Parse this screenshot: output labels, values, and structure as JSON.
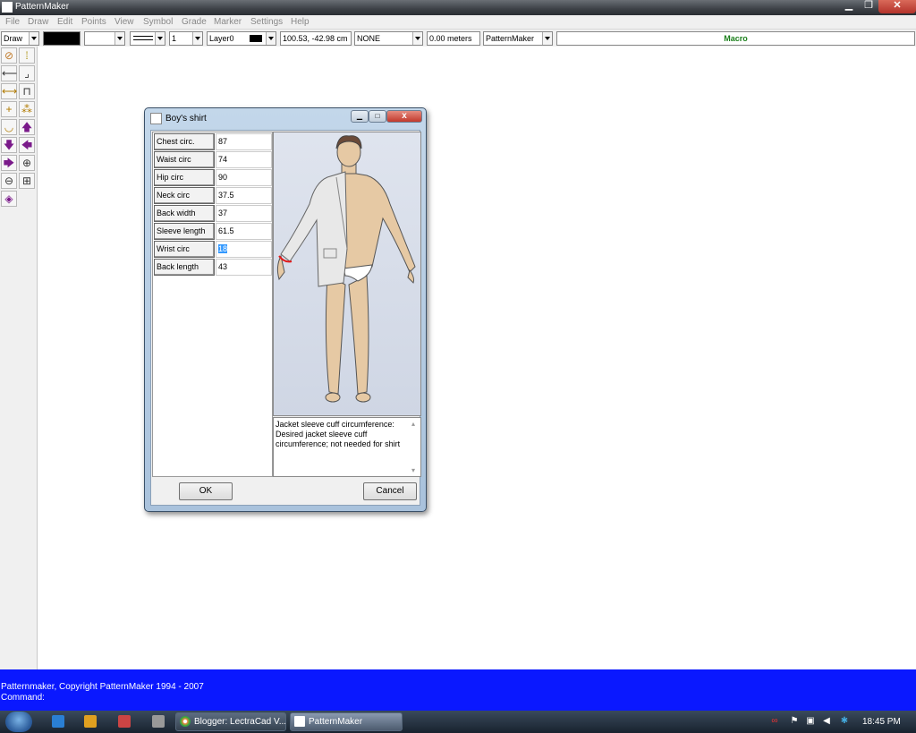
{
  "window": {
    "title": "PatternMaker",
    "min_glyph": "▁",
    "max_glyph": "❐",
    "close_glyph": "✕"
  },
  "menu": [
    "File",
    "Draw",
    "Edit",
    "Points",
    "View",
    "Symbol",
    "Grade",
    "Marker",
    "Settings",
    "Help"
  ],
  "toolbar": {
    "mode": "Draw",
    "line_width": "1",
    "layer": "Layer0",
    "coordinates": "100.53, -42.98 cm",
    "snap": "NONE",
    "distance": "0.00 meters",
    "app": "PatternMaker",
    "macro": "Macro"
  },
  "dialog": {
    "title": "Boy's shirt",
    "min_glyph": "▁",
    "max_glyph": "□",
    "close_glyph": "x",
    "measurements": [
      {
        "label": "Chest circ.",
        "value": "87"
      },
      {
        "label": "Waist circ",
        "value": "74"
      },
      {
        "label": "Hip circ",
        "value": "90"
      },
      {
        "label": "Neck circ",
        "value": "37.5"
      },
      {
        "label": "Back width",
        "value": "37"
      },
      {
        "label": "Sleeve length",
        "value": "61.5"
      },
      {
        "label": "Wrist circ",
        "value": "18"
      },
      {
        "label": "Back length",
        "value": "43"
      }
    ],
    "selected_row": 6,
    "description": "Jacket sleeve cuff circumference: Desired jacket sleeve cuff circumference; not needed for shirt",
    "ok": "OK",
    "cancel": "Cancel"
  },
  "status": {
    "line1": "Patternmaker, Copyright PatternMaker 1994 - 2007",
    "line2": "Command:"
  },
  "taskbar": {
    "tasks": [
      "Blogger: LectraCad V...",
      "PatternMaker"
    ],
    "active_task": 1,
    "clock": "18:45 PM"
  },
  "colors": {
    "status_bg": "#0a18ff",
    "macro_text": "#1a7f1a",
    "selection": "#3399ff",
    "tool_icon": "#7a1a8a"
  }
}
